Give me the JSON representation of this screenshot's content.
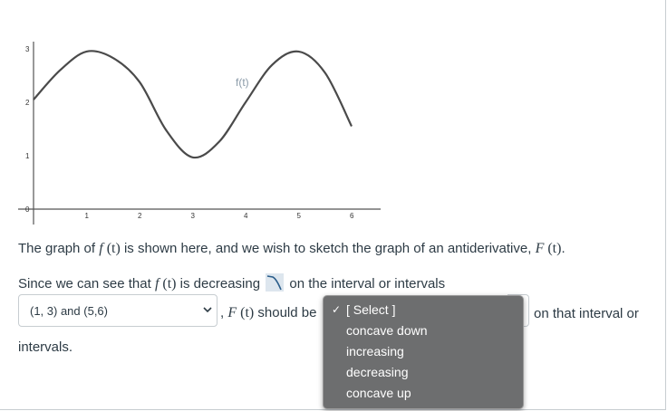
{
  "graph": {
    "y_ticks": [
      "0",
      "1",
      "2",
      "3"
    ],
    "x_ticks": [
      "1",
      "2",
      "3",
      "4",
      "5",
      "6"
    ],
    "curve_label": "f(t)"
  },
  "chart_data": {
    "type": "line",
    "series": [
      {
        "name": "f(t)",
        "x": [
          0,
          0.5,
          1,
          1.5,
          2,
          2.5,
          3,
          3.5,
          4,
          4.5,
          5,
          5.5,
          6
        ],
        "values": [
          2.05,
          2.6,
          2.95,
          2.83,
          2.38,
          1.48,
          0.97,
          1.26,
          2.0,
          2.7,
          2.95,
          2.55,
          1.55
        ]
      }
    ],
    "xlim": [
      0,
      6.5
    ],
    "ylim": [
      0,
      3.2
    ],
    "grid": false
  },
  "question": {
    "line1_pre": "The graph of ",
    "f": "f",
    "t_paren": " (t)",
    "line1_mid": " is shown here, and we wish to sketch the graph of an antiderivative, ",
    "F": "F",
    "line1_end": ".",
    "line2_pre": "Since we can see that ",
    "line2_mid": " is decreasing ",
    "line2_end": " on the interval or intervals",
    "comma": ", ",
    "should_be": " should be",
    "after_select": "on that interval or",
    "line4": "intervals."
  },
  "select_interval": {
    "value": "(1, 3) and (5,6)"
  },
  "dropdown": {
    "options": [
      {
        "label": "[ Select ]",
        "checked": true
      },
      {
        "label": "concave down",
        "checked": false
      },
      {
        "label": "increasing",
        "checked": false
      },
      {
        "label": "decreasing",
        "checked": false
      },
      {
        "label": "concave up",
        "checked": false
      }
    ],
    "check_glyph": "✓"
  }
}
